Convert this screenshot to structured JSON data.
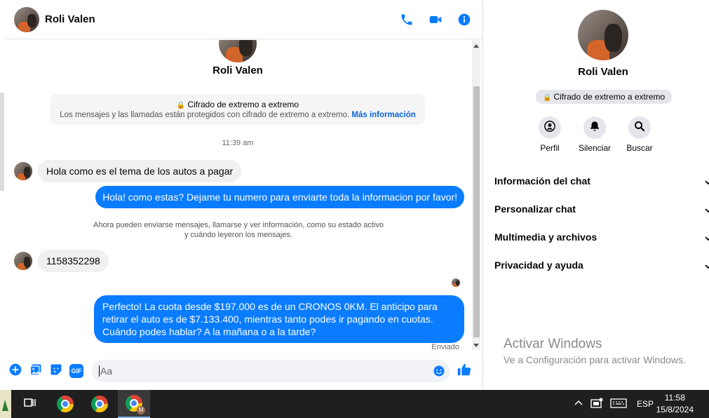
{
  "header": {
    "contact_name": "Roli Valen"
  },
  "conversation": {
    "contact_name": "Roli Valen",
    "encryption_title": "Cifrado de extremo a extremo",
    "encryption_desc": "Los mensajes y las llamadas están protegidos con cifrado de extremo a extremo.",
    "encryption_link": "Más información",
    "timestamp": "11:39 am",
    "messages": [
      {
        "direction": "in",
        "text": "Hola como es el tema de los autos a pagar"
      },
      {
        "direction": "out",
        "text": "Hola! como estas? Dejame tu numero para enviarte toda la informacion por favor!"
      },
      {
        "direction": "in",
        "text": "1158352298"
      },
      {
        "direction": "out",
        "text": "Perfecto! La cuota desde $197.000 es de un CRONOS 0KM. El anticipo para retirar el auto es de $7.133.400, mientras tanto podes ir pagando en cuotas. Cuándo podes hablar? A la mañana o a la tarde?"
      }
    ],
    "notice_line1": "Ahora pueden enviarse mensajes, llamarse y ver información, como su estado activo",
    "notice_line2": "y cuándo leyeron los mensajes.",
    "sent_status": "Enviado"
  },
  "composer": {
    "placeholder": "Aa",
    "gif_label": "GIF"
  },
  "info_panel": {
    "name": "Roli Valen",
    "encryption_badge": "Cifrado de extremo a extremo",
    "actions": [
      {
        "label": "Perfil",
        "icon": "profile-icon"
      },
      {
        "label": "Silenciar",
        "icon": "bell-icon"
      },
      {
        "label": "Buscar",
        "icon": "search-icon"
      }
    ],
    "sections": [
      "Información del chat",
      "Personalizar chat",
      "Multimedia y archivos",
      "Privacidad y ayuda"
    ]
  },
  "watermark": {
    "title": "Activar Windows",
    "subtitle": "Ve a Configuración para activar Windows."
  },
  "taskbar": {
    "language": "ESP",
    "time": "11:58",
    "date": "15/8/2024",
    "profile_badge": "M"
  },
  "colors": {
    "accent": "#0a7cff",
    "link": "#0b64d8",
    "taskbar": "#1f1f1f"
  }
}
